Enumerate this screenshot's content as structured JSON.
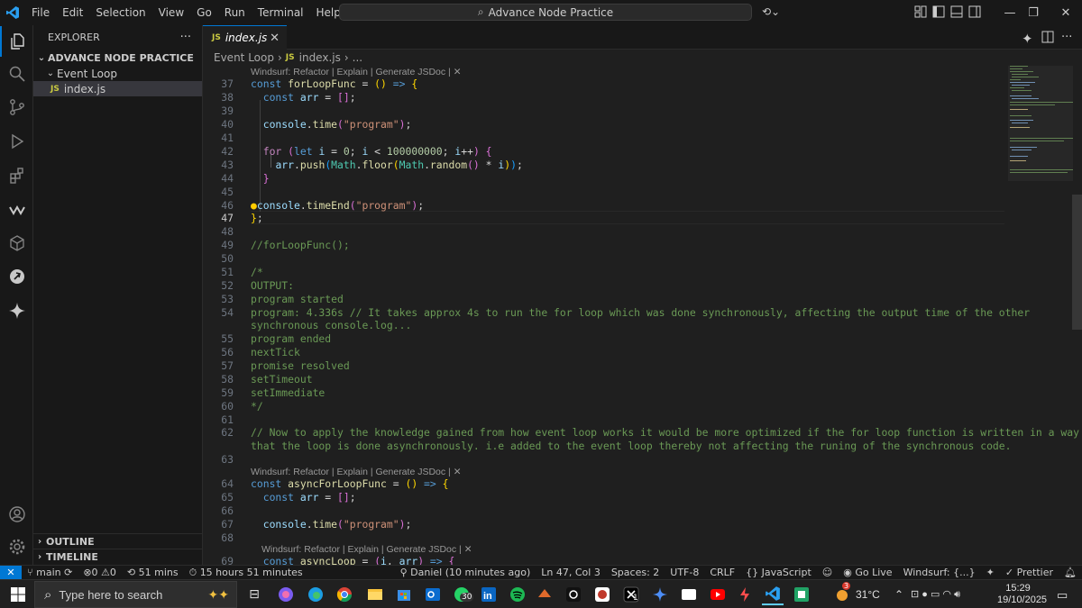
{
  "window": {
    "menu": [
      "File",
      "Edit",
      "Selection",
      "View",
      "Go",
      "Run",
      "Terminal",
      "Help"
    ],
    "search_text": "Advance Node Practice"
  },
  "sidebar": {
    "title": "EXPLORER",
    "more": "···",
    "project": "ADVANCE NODE PRACTICE",
    "folder": "Event Loop",
    "file": "index.js",
    "outline": "OUTLINE",
    "timeline": "TIMELINE"
  },
  "tabs": [
    {
      "badge": "JS",
      "label": "index.js",
      "close": "✕"
    }
  ],
  "breadcrumb": {
    "folder": "Event Loop",
    "badge": "JS",
    "file": "index.js",
    "more": "..."
  },
  "codelens": {
    "text": "Windsurf: Refactor | Explain | Generate JSDoc | ✕"
  },
  "lines": [
    37,
    38,
    39,
    40,
    41,
    42,
    43,
    44,
    45,
    46,
    47,
    48,
    49,
    50,
    51,
    52,
    53,
    54,
    55,
    56,
    57,
    58,
    59,
    60,
    61,
    62,
    63,
    64,
    65,
    66,
    67,
    68,
    69
  ],
  "current_line": 47,
  "code": {
    "l54a": "program: 4.336s // It takes approx 4s to run the for loop which was done synchronously, affecting the output time of the other",
    "l54b": "synchronous console.log...",
    "l62a": "// Now to apply the knowledge gained from how event loop works it would be more optimized if the for loop function is written in a way",
    "l62b": "that the loop is done asynchronously. i.e added to the event loop thereby not affecting the runing of the synchronous code.",
    "l49": "//forLoopFunc();",
    "l51": "/*",
    "l52": "OUTPUT:",
    "l53": "program started",
    "l55": "program ended",
    "l56": "nextTick",
    "l57": "promise resolved",
    "l58": "setTimeout",
    "l59": "setImmediate",
    "l60": "*/"
  },
  "statusbar": {
    "remote": "✕",
    "branch": "main",
    "errors": "0",
    "warnings": "0",
    "time_tracked": "51 mins",
    "session": "15 hours 51 minutes",
    "blame": "Daniel (10 minutes ago)",
    "position": "Ln 47, Col 3",
    "spaces": "Spaces: 2",
    "encoding": "UTF-8",
    "eol": "CRLF",
    "language": "JavaScript",
    "golive": "Go Live",
    "windsurf": "Windsurf: {...}",
    "prettier": "Prettier"
  },
  "taskbar": {
    "search_placeholder": "Type here to search",
    "whatsapp_badge": "30",
    "x_badge": "1",
    "weather_badge": "3",
    "temperature": "31°C",
    "time": "15:29",
    "date": "19/10/2025"
  },
  "colors": {
    "accent": "#0078d4",
    "editor_bg": "#1f1f1f",
    "chrome_bg": "#181818"
  }
}
